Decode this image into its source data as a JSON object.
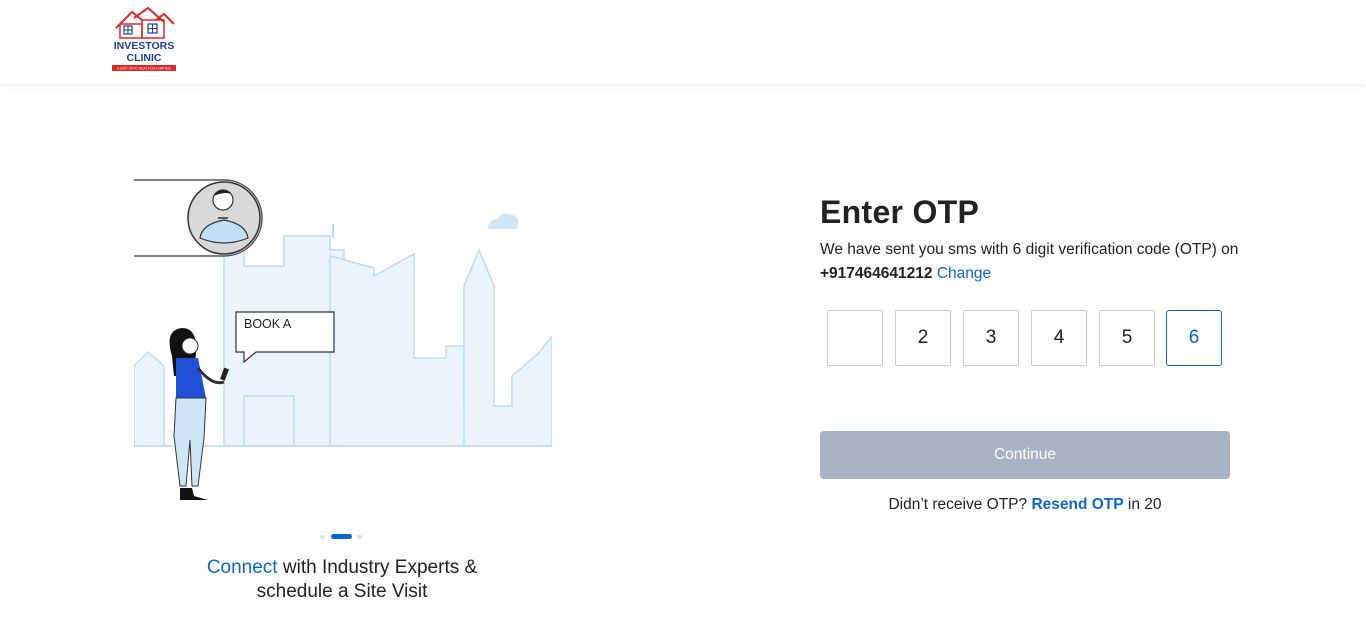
{
  "header": {
    "logo": {
      "line1": "INVESTORS",
      "line2": "CLINIC",
      "tagline": "A UNIT OF IC REALTECH LIMITED"
    }
  },
  "illustration": {
    "bubble_text": "BOOK A"
  },
  "carousel": {
    "slide_count": 3,
    "active_index": 1,
    "caption_highlight": "Connect",
    "caption_rest": " with Industry Experts &",
    "caption_line2": "schedule a Site Visit"
  },
  "otp": {
    "title": "Enter OTP",
    "description": "We have sent you sms with 6 digit verification code (OTP) on ",
    "phone": "+917464641212",
    "change_label": "Change",
    "digits": [
      "",
      "2",
      "3",
      "4",
      "5",
      "6"
    ],
    "focused_index": 5,
    "continue_label": "Continue",
    "resend_prefix": "Didn’t receive OTP? ",
    "resend_label": "Resend OTP",
    "resend_suffix": " in 20"
  },
  "colors": {
    "accent": "#0a66d9",
    "button_disabled": "#a7b2c2",
    "logo_red": "#e32626",
    "logo_blue": "#1f3e9c"
  }
}
